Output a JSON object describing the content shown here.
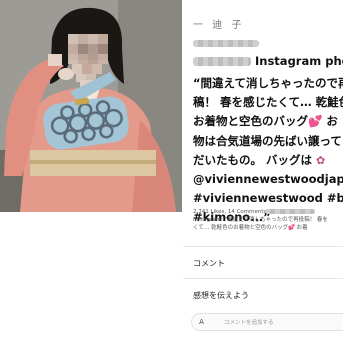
{
  "post": {
    "account_name": "一 迪 子",
    "title_suffix": "Instagram pho",
    "caption_lines": [
      "“間違えて消しちゃったので再",
      "稿！ 春を感じたくて… 乾鮭色",
      "お着物と空色のバッグ💕 お",
      "物は合気道場の先ばい譲ってい",
      "だいたもの。 バッグは",
      "@viviennewestwoodjapan",
      "#viviennewestwood #bag",
      "#kimono...”"
    ],
    "meta_lines": [
      "2,741 Likes, 14 Comments -",
      "Instagram: “間違えて消しちゃったので再投稿！ 春を",
      "くて… 乾鮭色のお着物と空色のバッグ💕 お着"
    ]
  },
  "comments": {
    "heading": "コメント",
    "feedback_label": "感想を伝えよう",
    "avatar_initial": "A",
    "input_placeholder": "コメントを追加する"
  },
  "icons": {
    "flower": "flower-icon",
    "heart": "heart-icon"
  },
  "colors": {
    "flower": "#c14c8b",
    "kimono": "#e79a8a",
    "bag": "#9ec3d6"
  }
}
